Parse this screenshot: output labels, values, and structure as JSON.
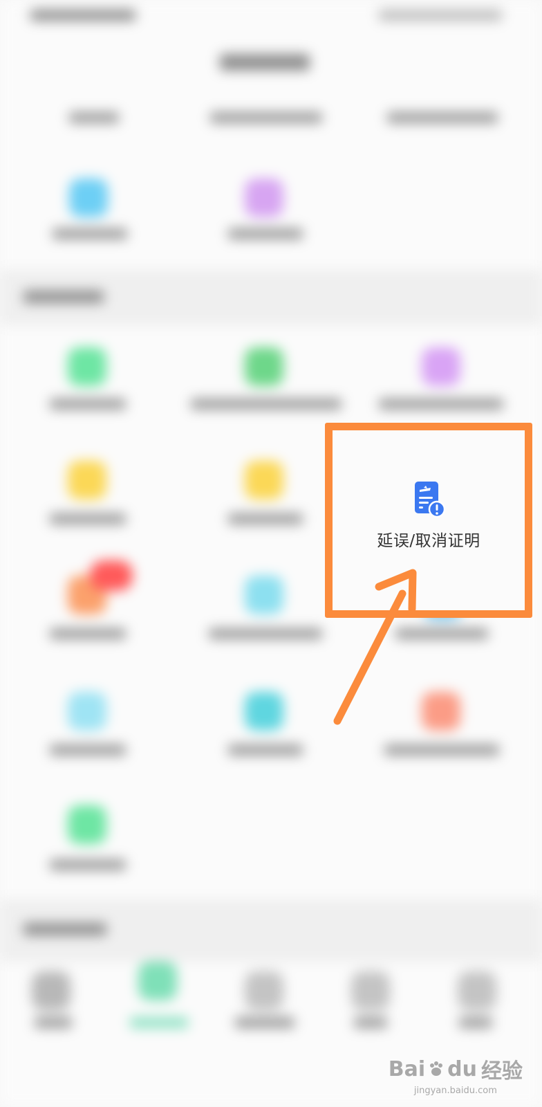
{
  "highlighted_item": {
    "label": "延误/取消证明",
    "icon": "flight-delay-certificate-icon"
  },
  "colors": {
    "highlight": "#fb8b3c",
    "icon_blue": "#3b78f0"
  },
  "watermark": {
    "brand_left": "Bai",
    "brand_right": "du",
    "brand_cn": "经验",
    "url": "jingyan.baidu.com"
  }
}
